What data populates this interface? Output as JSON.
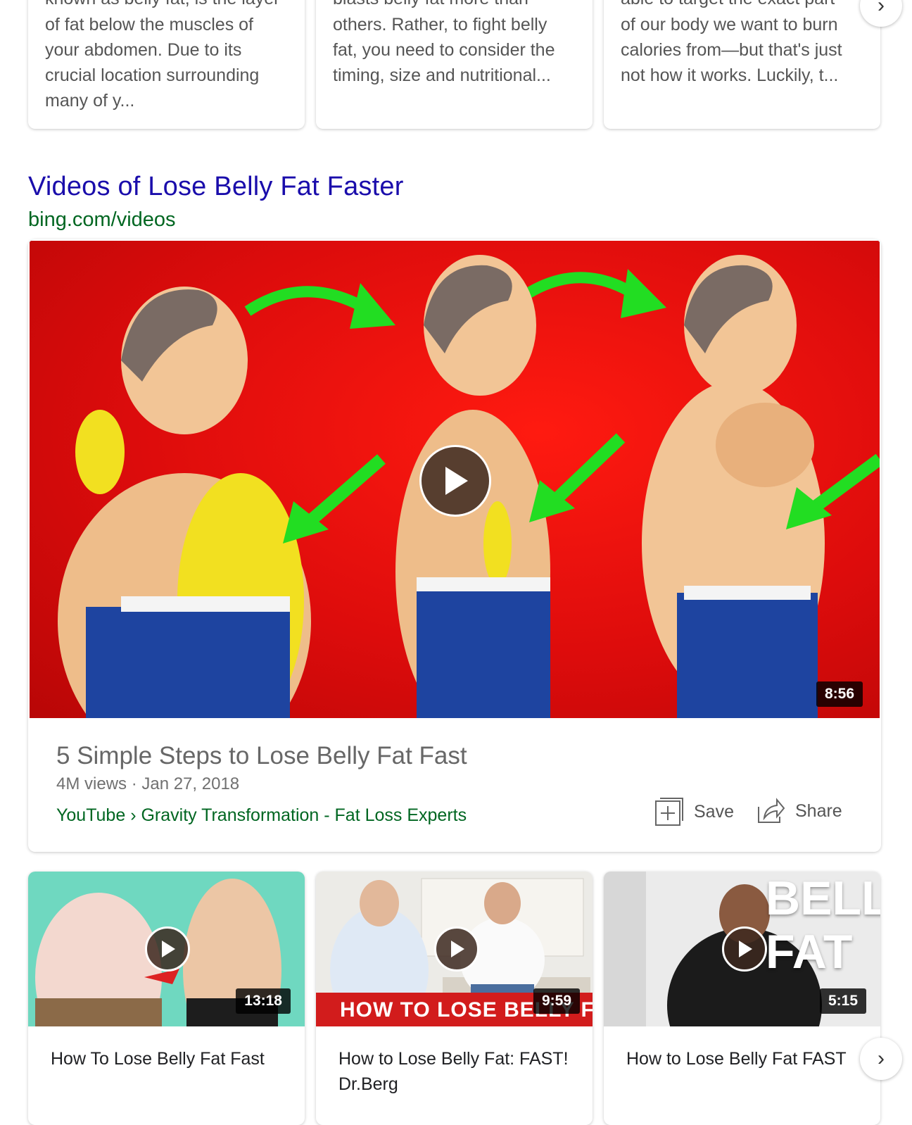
{
  "top_cards": [
    {
      "lines": [
        "known as belly fat, is the layer",
        "of fat below the muscles of",
        "your abdomen. Due to its",
        "crucial location surrounding",
        "many of y..."
      ]
    },
    {
      "lines": [
        "blasts belly fat more than",
        "others. Rather, to fight belly",
        "fat, you need to consider the",
        "timing, size and nutritional..."
      ]
    },
    {
      "lines": [
        "able to target the exact part",
        "of our body we want to burn",
        "calories from—but that's just",
        "not how it works. Luckily, t..."
      ]
    }
  ],
  "section": {
    "title": "Videos of Lose Belly Fat Faster",
    "url": "bing.com/videos"
  },
  "featured_video": {
    "duration": "8:56",
    "title": "5 Simple Steps to Lose Belly Fat Fast",
    "meta": "4M views · Jan 27, 2018",
    "source": "YouTube › Gravity Transformation - Fat Loss Experts",
    "save_label": "Save",
    "share_label": "Share"
  },
  "small_videos": [
    {
      "title": "How To Lose Belly Fat Fast",
      "duration": "13:18"
    },
    {
      "title": "How to Lose Belly Fat: FAST! Dr.Berg",
      "duration": "9:59",
      "banner": "HOW TO LOSE BELLY FAT"
    },
    {
      "title": "How to Lose Belly Fat FAST",
      "duration": "5:15",
      "overlay": "BELLY FAT"
    }
  ],
  "colors": {
    "link_blue": "#1a0dab",
    "url_green": "#006621",
    "thumb_red": "#e0100f",
    "arrow_green": "#22dd22"
  }
}
